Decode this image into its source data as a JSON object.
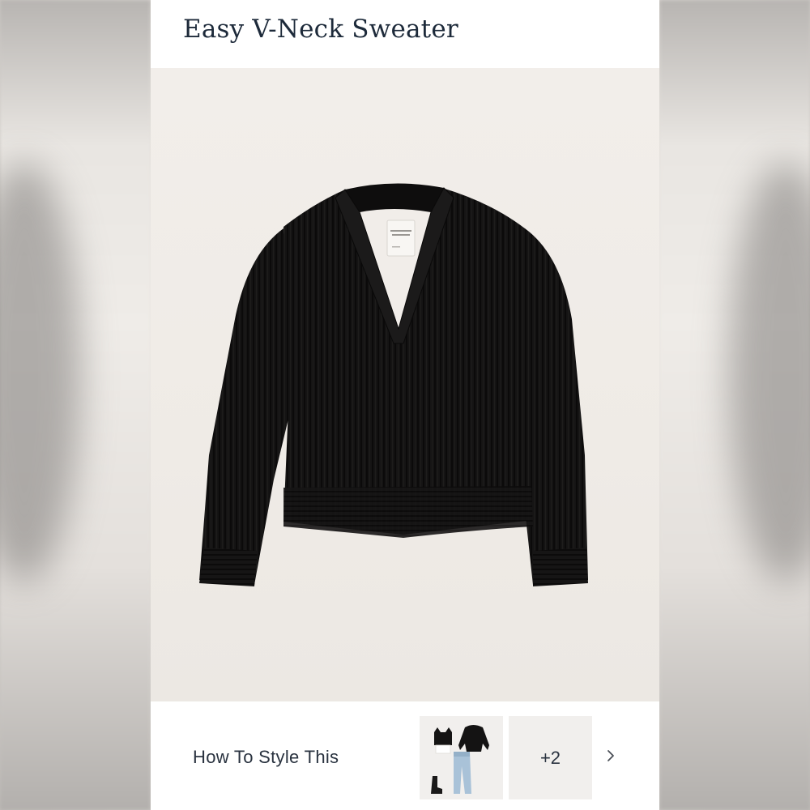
{
  "product": {
    "title": "Easy V-Neck Sweater",
    "image": {
      "description_icon": "sweater-image",
      "garment_color": "#141313",
      "background_color": "#efebe6",
      "tag_text": "Abercrombie & Fitch"
    }
  },
  "style_section": {
    "label": "How To Style This",
    "more_count": "+2",
    "next_icon": "chevron-right-icon"
  },
  "colors": {
    "title": "#1d2a3a",
    "text": "#2a3340",
    "thumb_bg": "#f1efed"
  }
}
